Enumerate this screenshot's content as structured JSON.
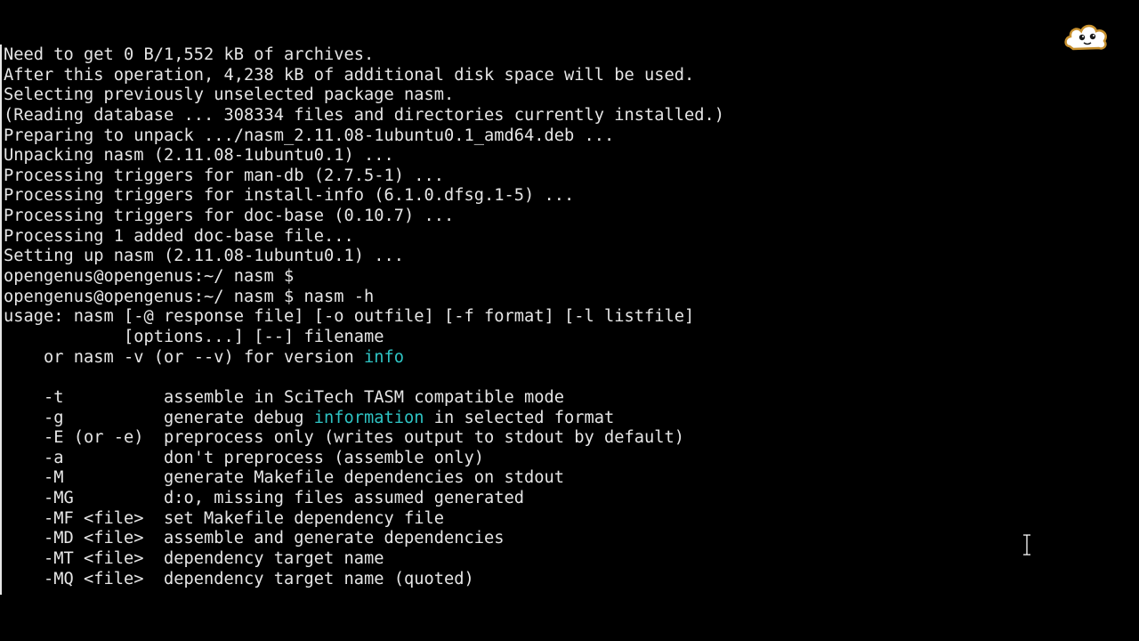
{
  "terminal": {
    "lines": [
      [
        {
          "text": "Need to get 0 B/1,552 kB of archives."
        }
      ],
      [
        {
          "text": "After this operation, 4,238 kB of additional disk space will be used."
        }
      ],
      [
        {
          "text": "Selecting previously unselected package nasm."
        }
      ],
      [
        {
          "text": "(Reading database ... 308334 files and directories currently installed.)"
        }
      ],
      [
        {
          "text": "Preparing to unpack .../nasm_2.11.08-1ubuntu0.1_amd64.deb ..."
        }
      ],
      [
        {
          "text": "Unpacking nasm (2.11.08-1ubuntu0.1) ..."
        }
      ],
      [
        {
          "text": "Processing triggers for man-db (2.7.5-1) ..."
        }
      ],
      [
        {
          "text": "Processing triggers for install-info (6.1.0.dfsg.1-5) ..."
        }
      ],
      [
        {
          "text": "Processing triggers for doc-base (0.10.7) ..."
        }
      ],
      [
        {
          "text": "Processing 1 added doc-base file..."
        }
      ],
      [
        {
          "text": "Setting up nasm (2.11.08-1ubuntu0.1) ..."
        }
      ],
      [
        {
          "text": "opengenus@opengenus:~/ nasm $"
        }
      ],
      [
        {
          "text": "opengenus@opengenus:~/ nasm $ nasm -h"
        }
      ],
      [
        {
          "text": "usage: nasm [-@ response file] [-o outfile] [-f format] [-l listfile]"
        }
      ],
      [
        {
          "text": "            [options...] [--] filename"
        }
      ],
      [
        {
          "text": "    or nasm -v (or --v) for version "
        },
        {
          "text": "info",
          "color": "#2ec4c4"
        }
      ],
      [
        {
          "text": ""
        }
      ],
      [
        {
          "text": "    -t          assemble in SciTech TASM compatible mode"
        }
      ],
      [
        {
          "text": "    -g          generate debug "
        },
        {
          "text": "information",
          "color": "#2ec4c4"
        },
        {
          "text": " in selected format"
        }
      ],
      [
        {
          "text": "    -E (or -e)  preprocess only (writes output to stdout by default)"
        }
      ],
      [
        {
          "text": "    -a          don't preprocess (assemble only)"
        }
      ],
      [
        {
          "text": "    -M          generate Makefile dependencies on stdout"
        }
      ],
      [
        {
          "text": "    -MG         d:o, missing files assumed generated"
        }
      ],
      [
        {
          "text": "    -MF <file>  set Makefile dependency file"
        }
      ],
      [
        {
          "text": "    -MD <file>  assemble and generate dependencies"
        }
      ],
      [
        {
          "text": "    -MT <file>  dependency target name"
        }
      ],
      [
        {
          "text": "    -MQ <file>  dependency target name (quoted)"
        }
      ]
    ]
  },
  "colors": {
    "background": "#000000",
    "foreground": "#e6e6e6",
    "highlight": "#2ec4c4"
  },
  "icons": {
    "watermark": "cloud-mascot-icon",
    "cursor": "text-cursor-icon"
  }
}
